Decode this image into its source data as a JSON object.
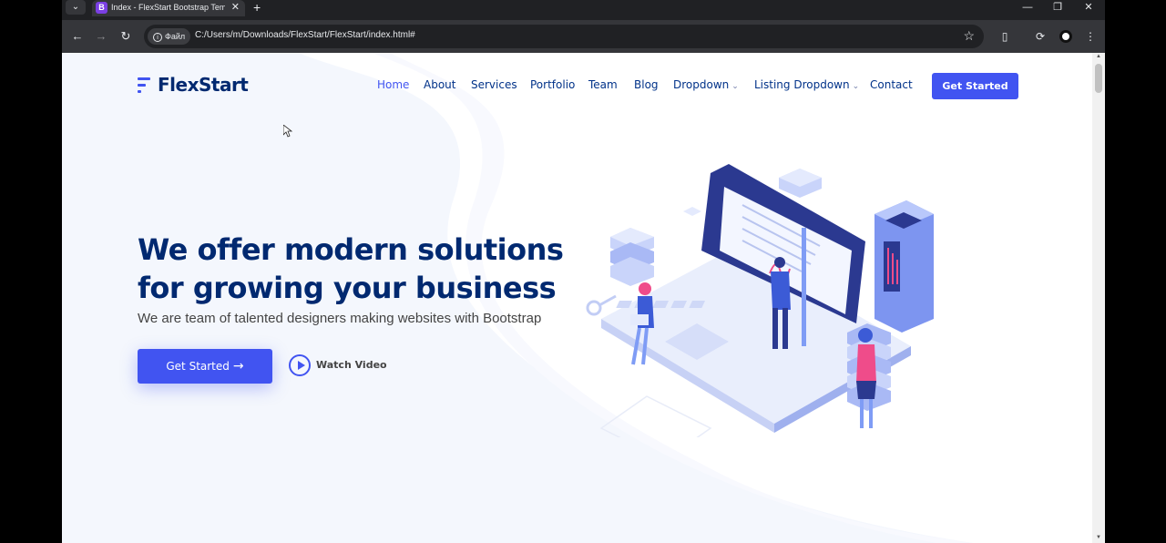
{
  "browser": {
    "tab_title": "Index - FlexStart Bootstrap Tem",
    "tab_favicon": "B",
    "tab_close": "✕",
    "new_tab": "+",
    "site_chip": "Файл",
    "url": "C:/Users/m/Downloads/FlexStart/FlexStart/index.html#",
    "icons": [
      "tab-list-icon",
      "back-icon",
      "forward-icon",
      "reload-icon",
      "info-icon",
      "bookmark-star-icon",
      "extensions-icon",
      "sync-icon",
      "profile-icon",
      "menu-icon",
      "minimize-icon",
      "restore-icon",
      "close-window-icon"
    ]
  },
  "header": {
    "logo_text": "FlexStart",
    "nav": [
      {
        "label": "Home",
        "active": true
      },
      {
        "label": "About"
      },
      {
        "label": "Services"
      },
      {
        "label": "Portfolio"
      },
      {
        "label": "Team"
      },
      {
        "label": "Blog"
      },
      {
        "label": "Dropdown",
        "has_chevron": true
      },
      {
        "label": "Listing Dropdown",
        "has_chevron": true
      },
      {
        "label": "Contact"
      }
    ],
    "cta": "Get Started"
  },
  "hero": {
    "title": "We offer modern solutions for growing your business",
    "subtitle": "We are team of talented designers making websites with Bootstrap",
    "primary_button": "Get Started",
    "secondary_button": "Watch Video"
  },
  "colors": {
    "accent": "#4154f1",
    "heading": "#012970",
    "nav_text": "#013289",
    "bg_wave": "#f4f7fd"
  }
}
